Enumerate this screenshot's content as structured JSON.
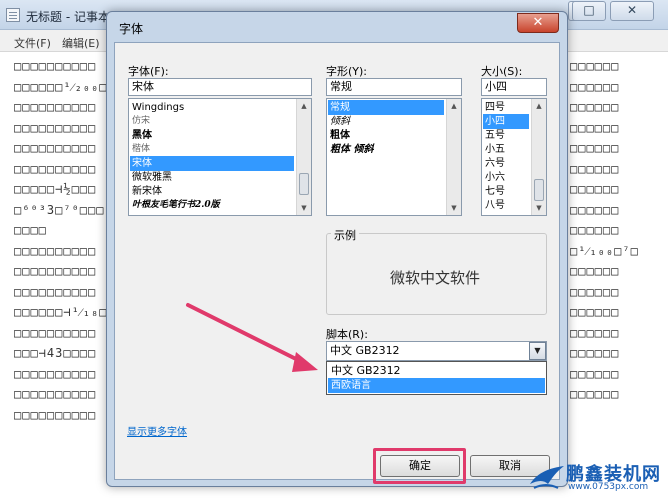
{
  "notepad": {
    "title": "无标题 - 记事本",
    "menus": [
      "文件(F)",
      "编辑(E)"
    ],
    "window_controls": [
      "—",
      "□",
      "✕"
    ],
    "lines_left": [
      "□□□□□□□□□□",
      "□□□□□□¹⁄₂₀₀□□",
      "□□□□□□□□□□",
      "□□□□□□□□□□",
      "□□□□□□□□□□",
      "□□□□□□□□□□",
      "□□□□□⊣½□□□",
      "□⁶⁰³3□⁷⁰□□□",
      "□□□□",
      "□□□□□□□□□□",
      "□□□□□□□□□□",
      "□□□□□□□□□□",
      "□□□□□□⊣¹⁄₁₈□",
      "□□□□□□□□□□",
      "□□□⊣43□□□□",
      "□□□□□□□□□□",
      "□□□□□□□□□□",
      "□□□□□□□□□□"
    ],
    "lines_right": [
      "□□□□□□",
      "□□□□□□",
      "□□□□□□",
      "□□□□□□",
      "□□□□□□",
      "□□□□□□",
      "□□□□□□",
      "□□□□□□",
      "□□□□□□",
      "□¹⁄₁₀₀□⁷□",
      "□□□□□□",
      "□□□□□□",
      "□□□□□□",
      "□□□□□□",
      "□□□□□□",
      "□□□□□□",
      "□□□□□□"
    ]
  },
  "dialog": {
    "title": "字体",
    "close_glyph": "✕",
    "font": {
      "label": "字体(F):",
      "value": "宋体",
      "items": [
        {
          "text": "Wingdings",
          "style": "",
          "selected": false
        },
        {
          "text": "仿宋",
          "style": "light",
          "selected": false
        },
        {
          "text": "黑体",
          "style": "bold",
          "selected": false
        },
        {
          "text": "楷体",
          "style": "light",
          "selected": false
        },
        {
          "text": "宋体",
          "style": "",
          "selected": true
        },
        {
          "text": "微软雅黑",
          "style": "",
          "selected": false
        },
        {
          "text": "新宋体",
          "style": "",
          "selected": false
        },
        {
          "text": "叶根友毛笔行书2.0版",
          "style": "script",
          "selected": false
        }
      ]
    },
    "style": {
      "label": "字形(Y):",
      "value": "常规",
      "items": [
        {
          "text": "常规",
          "style": "",
          "selected": true
        },
        {
          "text": "倾斜",
          "style": "italic",
          "selected": false
        },
        {
          "text": "粗体",
          "style": "bold",
          "selected": false
        },
        {
          "text": "粗体 倾斜",
          "style": "bolditalic",
          "selected": false
        }
      ]
    },
    "size": {
      "label": "大小(S):",
      "value": "小四",
      "items": [
        {
          "text": "四号",
          "style": "",
          "selected": false
        },
        {
          "text": "小四",
          "style": "",
          "selected": true
        },
        {
          "text": "五号",
          "style": "",
          "selected": false
        },
        {
          "text": "小五",
          "style": "",
          "selected": false
        },
        {
          "text": "六号",
          "style": "",
          "selected": false
        },
        {
          "text": "小六",
          "style": "",
          "selected": false
        },
        {
          "text": "七号",
          "style": "",
          "selected": false
        },
        {
          "text": "八号",
          "style": "",
          "selected": false
        }
      ]
    },
    "sample": {
      "label": "示例",
      "text": "微软中文软件"
    },
    "script": {
      "label": "脚本(R):",
      "value": "中文 GB2312",
      "options": [
        {
          "text": "中文 GB2312",
          "selected": false
        },
        {
          "text": "西欧语言",
          "selected": true
        }
      ]
    },
    "more_fonts_link": "显示更多字体",
    "ok_label": "确定",
    "cancel_label": "取消"
  },
  "annotation": {
    "arrow_color": "#e03a6b",
    "highlight_color": "#e03a6b"
  },
  "watermark": {
    "name": "鹏鑫装机网",
    "url": "www.0753px.com"
  }
}
